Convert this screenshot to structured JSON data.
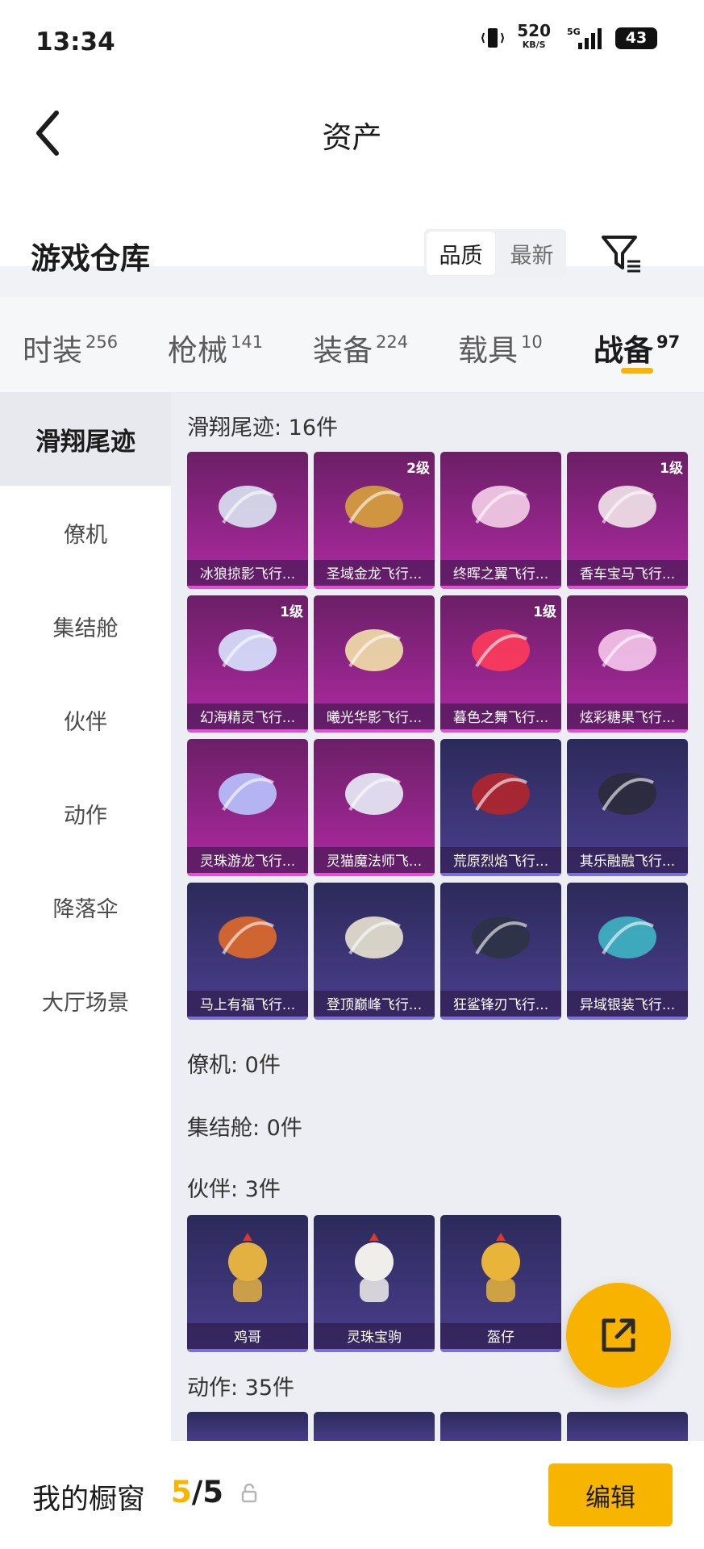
{
  "status_bar": {
    "time": "13:34",
    "speed_value": "520",
    "speed_unit": "KB/S",
    "network": "5G",
    "battery": "43"
  },
  "header": {
    "title": "资产",
    "section_title": "游戏仓库",
    "sort": [
      "品质",
      "最新"
    ]
  },
  "tabs": [
    {
      "label": "时装",
      "count": "256"
    },
    {
      "label": "枪械",
      "count": "141"
    },
    {
      "label": "装备",
      "count": "224"
    },
    {
      "label": "载具",
      "count": "10"
    },
    {
      "label": "战备",
      "count": "97"
    }
  ],
  "side_menu": [
    "滑翔尾迹",
    "僚机",
    "集结舱",
    "伙伴",
    "动作",
    "降落伞",
    "大厅场景"
  ],
  "groups": {
    "glide": "滑翔尾迹: 16件",
    "wingman": "僚机: 0件",
    "capsule": "集结舱: 0件",
    "partner": "伙伴: 3件",
    "action": "动作: 35件"
  },
  "glide_items": [
    {
      "name": "冰狼掠影飞行...",
      "level": ""
    },
    {
      "name": "圣域金龙飞行...",
      "level": "2级"
    },
    {
      "name": "终晖之翼飞行...",
      "level": ""
    },
    {
      "name": "香车宝马飞行...",
      "level": "1级"
    },
    {
      "name": "幻海精灵飞行...",
      "level": "1级"
    },
    {
      "name": "曦光华影飞行...",
      "level": ""
    },
    {
      "name": "暮色之舞飞行...",
      "level": "1级"
    },
    {
      "name": "炫彩糖果飞行...",
      "level": ""
    },
    {
      "name": "灵珠游龙飞行...",
      "level": ""
    },
    {
      "name": "灵猫魔法师飞...",
      "level": ""
    },
    {
      "name": "荒原烈焰飞行...",
      "level": ""
    },
    {
      "name": "其乐融融飞行...",
      "level": ""
    },
    {
      "name": "马上有福飞行...",
      "level": ""
    },
    {
      "name": "登顶巅峰飞行...",
      "level": ""
    },
    {
      "name": "狂鲨锋刃飞行...",
      "level": ""
    },
    {
      "name": "异域银装飞行...",
      "level": ""
    }
  ],
  "partner_items": [
    "鸡哥",
    "灵珠宝驹",
    "盔仔"
  ],
  "bottom_bar": {
    "label": "我的橱窗",
    "current": "5",
    "total": "/5",
    "edit": "编辑"
  },
  "colors": {
    "accent": "#f8b500",
    "card_magenta": "#b02aa4",
    "card_blue": "#4b3f8f"
  }
}
